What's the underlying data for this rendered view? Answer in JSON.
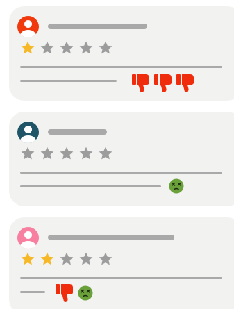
{
  "colors": {
    "card_bg": "#f2f2f0",
    "placeholder_gray": "#a9a9a9",
    "star_filled": "#f6b826",
    "star_empty": "#9c9c9c",
    "thumb_down": "#ef2d0c",
    "face_green": "#6aa13a"
  },
  "reviews": [
    {
      "avatar_color": "#f03a0e",
      "rating": 1,
      "rating_max": 5,
      "reactions": [
        "thumbs-down",
        "thumbs-down",
        "thumbs-down"
      ]
    },
    {
      "avatar_color": "#1f5566",
      "rating": 0,
      "rating_max": 5,
      "reactions": [
        "dizzy-face"
      ]
    },
    {
      "avatar_color": "#f77fa0",
      "rating": 2,
      "rating_max": 5,
      "reactions": [
        "thumbs-down",
        "dizzy-face"
      ]
    }
  ]
}
